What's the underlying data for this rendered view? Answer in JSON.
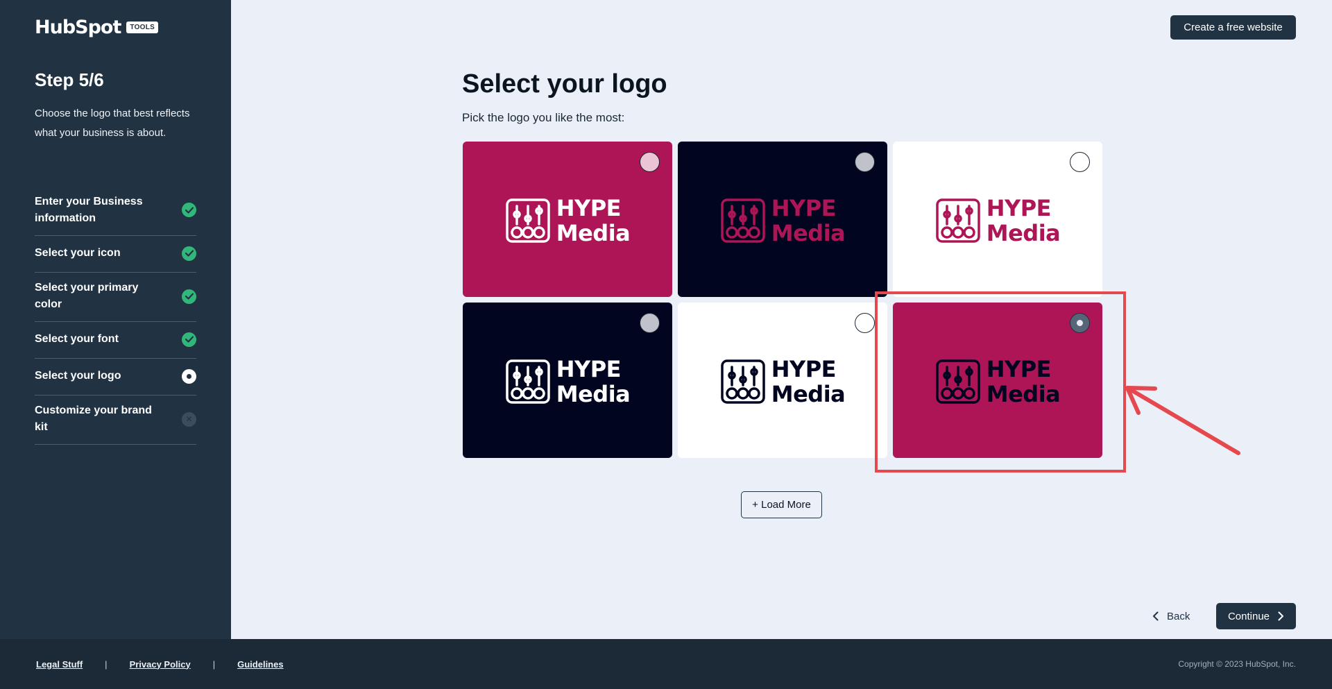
{
  "brand": {
    "name": "HubSpot",
    "badge": "TOOLS"
  },
  "sidebar": {
    "step_title": "Step 5/6",
    "description": "Choose the logo that best reflects what your business is about.",
    "steps": [
      {
        "label": "Enter your Business information",
        "status": "completed"
      },
      {
        "label": "Select your icon",
        "status": "completed"
      },
      {
        "label": "Select your primary color",
        "status": "completed"
      },
      {
        "label": "Select your font",
        "status": "completed"
      },
      {
        "label": "Select your logo",
        "status": "current"
      },
      {
        "label": "Customize your brand kit",
        "status": "pending"
      }
    ]
  },
  "header": {
    "create_website_label": "Create a free website"
  },
  "main": {
    "title": "Select your logo",
    "subtitle": "Pick the logo you like the most:",
    "logo_text_line1": "HYPE",
    "logo_text_line2": "Media",
    "options": [
      {
        "background": "#ad1556",
        "icon_color": "#ffffff",
        "text_color": "#ffffff",
        "radio": "pink",
        "selected": false
      },
      {
        "background": "#020520",
        "icon_color": "#ad1556",
        "text_color": "#ad1556",
        "radio": "gray",
        "selected": false
      },
      {
        "background": "#ffffff",
        "icon_color": "#ad1556",
        "text_color": "#ad1556",
        "radio": "white",
        "selected": false
      },
      {
        "background": "#020520",
        "icon_color": "#ffffff",
        "text_color": "#ffffff",
        "radio": "gray",
        "selected": false
      },
      {
        "background": "#ffffff",
        "icon_color": "#020520",
        "text_color": "#020520",
        "radio": "white",
        "selected": false
      },
      {
        "background": "#ad1556",
        "icon_color": "#020520",
        "text_color": "#020520",
        "radio": "checked",
        "selected": true
      }
    ],
    "load_more_label": "+ Load More"
  },
  "nav": {
    "back_label": "Back",
    "continue_label": "Continue"
  },
  "footer": {
    "links": [
      "Legal Stuff",
      "Privacy Policy",
      "Guidelines"
    ],
    "separator": "|",
    "copyright": "Copyright © 2023 HubSpot, Inc."
  },
  "colors": {
    "sidebar": "#213343",
    "accent_crimson": "#ad1556",
    "navy": "#020520",
    "success": "#2fb87a",
    "annotation": "#e5484d"
  },
  "icons": {
    "completed": "check-icon",
    "back": "chevron-left-icon",
    "continue": "chevron-right-icon",
    "logo_mark": "mixer-sliders-icon"
  }
}
